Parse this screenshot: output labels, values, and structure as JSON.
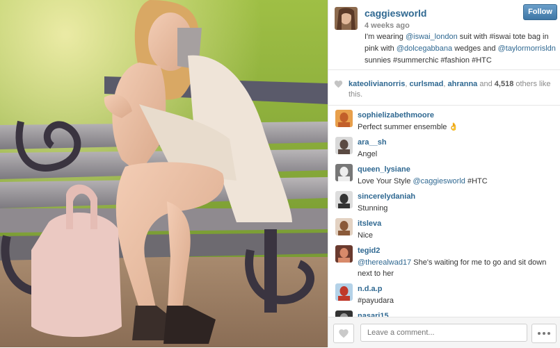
{
  "post": {
    "username": "caggiesworld",
    "time_ago": "4 weeks ago",
    "follow_label": "Follow",
    "caption": [
      {
        "text": "I'm wearing ",
        "mention": false
      },
      {
        "text": "@iswai_london",
        "mention": true
      },
      {
        "text": " suit with #iswai tote bag in pink with ",
        "mention": false
      },
      {
        "text": "@dolcegabbana",
        "mention": true
      },
      {
        "text": " wedges and ",
        "mention": false
      },
      {
        "text": "@taylormorrisldn",
        "mention": true
      },
      {
        "text": " sunnies #summerchic #fashion #HTC",
        "mention": false
      }
    ]
  },
  "likes": {
    "users": [
      "kateolivianorris",
      "curlsmad",
      "ahranna"
    ],
    "and_text": "and",
    "count": "4,518",
    "suffix": "others like this."
  },
  "comments": [
    {
      "user": "sophielizabethmoore",
      "parts": [
        {
          "text": "Perfect summer ensemble 👌",
          "mention": false
        }
      ]
    },
    {
      "user": "ara__sh",
      "parts": [
        {
          "text": "Angel",
          "mention": false
        }
      ]
    },
    {
      "user": "queen_lysiane",
      "parts": [
        {
          "text": "Love Your Style ",
          "mention": false
        },
        {
          "text": "@caggiesworld",
          "mention": true
        },
        {
          "text": " #HTC",
          "mention": false
        }
      ]
    },
    {
      "user": "sincerelydaniah",
      "parts": [
        {
          "text": "Stunning",
          "mention": false
        }
      ]
    },
    {
      "user": "itsleva",
      "parts": [
        {
          "text": "Nice",
          "mention": false
        }
      ]
    },
    {
      "user": "tegid2",
      "parts": [
        {
          "text": "@therealwad17",
          "mention": true
        },
        {
          "text": " She's waiting for me to go and sit down next to her",
          "mention": false
        }
      ]
    },
    {
      "user": "n.d.a.p",
      "parts": [
        {
          "text": "#payudara",
          "mention": false
        }
      ]
    },
    {
      "user": "nasari15",
      "parts": [
        {
          "text": "",
          "mention": false
        }
      ]
    }
  ],
  "comment_box": {
    "placeholder": "Leave a comment..."
  },
  "icons": {
    "like": "heart-icon",
    "more": "more-dots-icon"
  },
  "colors": {
    "link": "#2f6891",
    "follow_button": "#4a85b5"
  }
}
